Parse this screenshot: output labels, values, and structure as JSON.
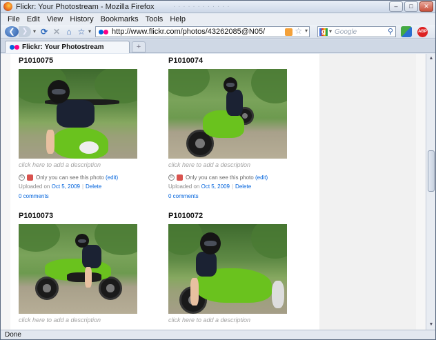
{
  "window": {
    "title": "Flickr: Your Photostream - Mozilla Firefox",
    "faded_text": "· · · · · · · · · · · ·",
    "minimize": "–",
    "maximize": "□",
    "close": "✕"
  },
  "menubar": [
    {
      "key": "F",
      "rest": "ile"
    },
    {
      "key": "E",
      "rest": "dit"
    },
    {
      "key": "V",
      "rest": "iew"
    },
    {
      "key": "Hi",
      "rest": "story",
      "u_index": 1
    },
    {
      "key": "B",
      "rest": "ookmarks"
    },
    {
      "key": "T",
      "rest": "ools"
    },
    {
      "key": "H",
      "rest": "elp"
    }
  ],
  "menu_labels": [
    "File",
    "Edit",
    "View",
    "History",
    "Bookmarks",
    "Tools",
    "Help"
  ],
  "nav": {
    "back_glyph": "❮",
    "forward_glyph": "❯",
    "reload_glyph": "⟳",
    "stop_glyph": "✕",
    "home_glyph": "⌂",
    "bookmark_glyph": "☆",
    "dropdown_glyph": "▾",
    "url": "http://www.flickr.com/photos/43262085@N05/",
    "search_placeholder": "Google",
    "search_engine_glyph": "g",
    "magnifier_glyph": "⚲",
    "star_glyph": "☆",
    "abp_label": "ABP"
  },
  "tabs": {
    "active_label": "Flickr: Your Photostream",
    "new_tab_glyph": "+"
  },
  "photos": [
    {
      "title": "P1010075",
      "description": "click here to add a description",
      "privacy": "Only you can see this photo",
      "edit": "(edit)",
      "uploaded_prefix": "Uploaded on",
      "date": "Oct 5, 2009",
      "delete": "Delete",
      "comments": "0 comments"
    },
    {
      "title": "P1010074",
      "description": "click here to add a description",
      "privacy": "Only you can see this photo",
      "edit": "(edit)",
      "uploaded_prefix": "Uploaded on",
      "date": "Oct 5, 2009",
      "delete": "Delete",
      "comments": "0 comments"
    },
    {
      "title": "P1010073",
      "description": "click here to add a description"
    },
    {
      "title": "P1010072",
      "description": "click here to add a description"
    }
  ],
  "statusbar": {
    "status": "Done"
  },
  "colors": {
    "flickr_blue": "#0063dc",
    "flickr_pink": "#ff0084",
    "bike_green": "#6ac21e"
  }
}
